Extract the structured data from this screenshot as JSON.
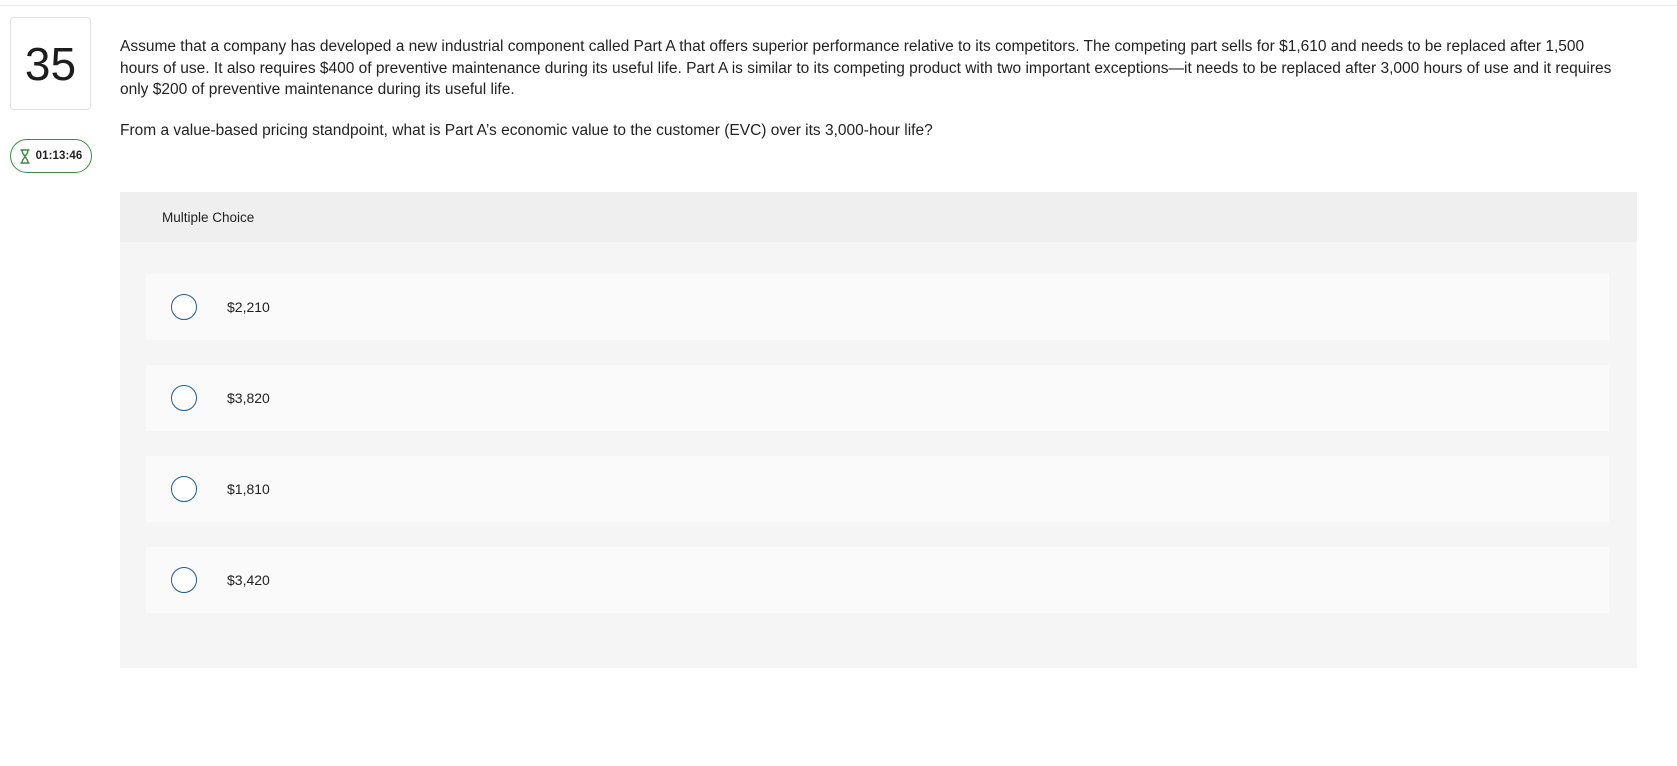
{
  "question": {
    "number": "35",
    "timer": "01:13:46",
    "body": "Assume that a company has developed a new industrial component called Part A that offers superior performance relative to its competitors. The competing part sells for $1,610 and needs to be replaced after 1,500 hours of use. It also requires $400 of preventive maintenance during its useful life. Part A is similar to its competing product with two important exceptions—it needs to be replaced after 3,000 hours of use and it requires only $200 of preventive maintenance during its useful life.",
    "prompt": "From a value-based pricing standpoint, what is Part A’s economic value to the customer (EVC) over its 3,000-hour life?"
  },
  "multiple_choice": {
    "header": "Multiple Choice",
    "options": [
      {
        "label": "$2,210"
      },
      {
        "label": "$3,820"
      },
      {
        "label": "$1,810"
      },
      {
        "label": "$3,420"
      }
    ]
  },
  "colors": {
    "timer_border": "#3e8a3e",
    "radio_border": "#1f5c99",
    "panel_bg": "#f5f5f5",
    "option_bg": "#fafafa"
  },
  "icons": {
    "timer": "hourglass-icon"
  }
}
